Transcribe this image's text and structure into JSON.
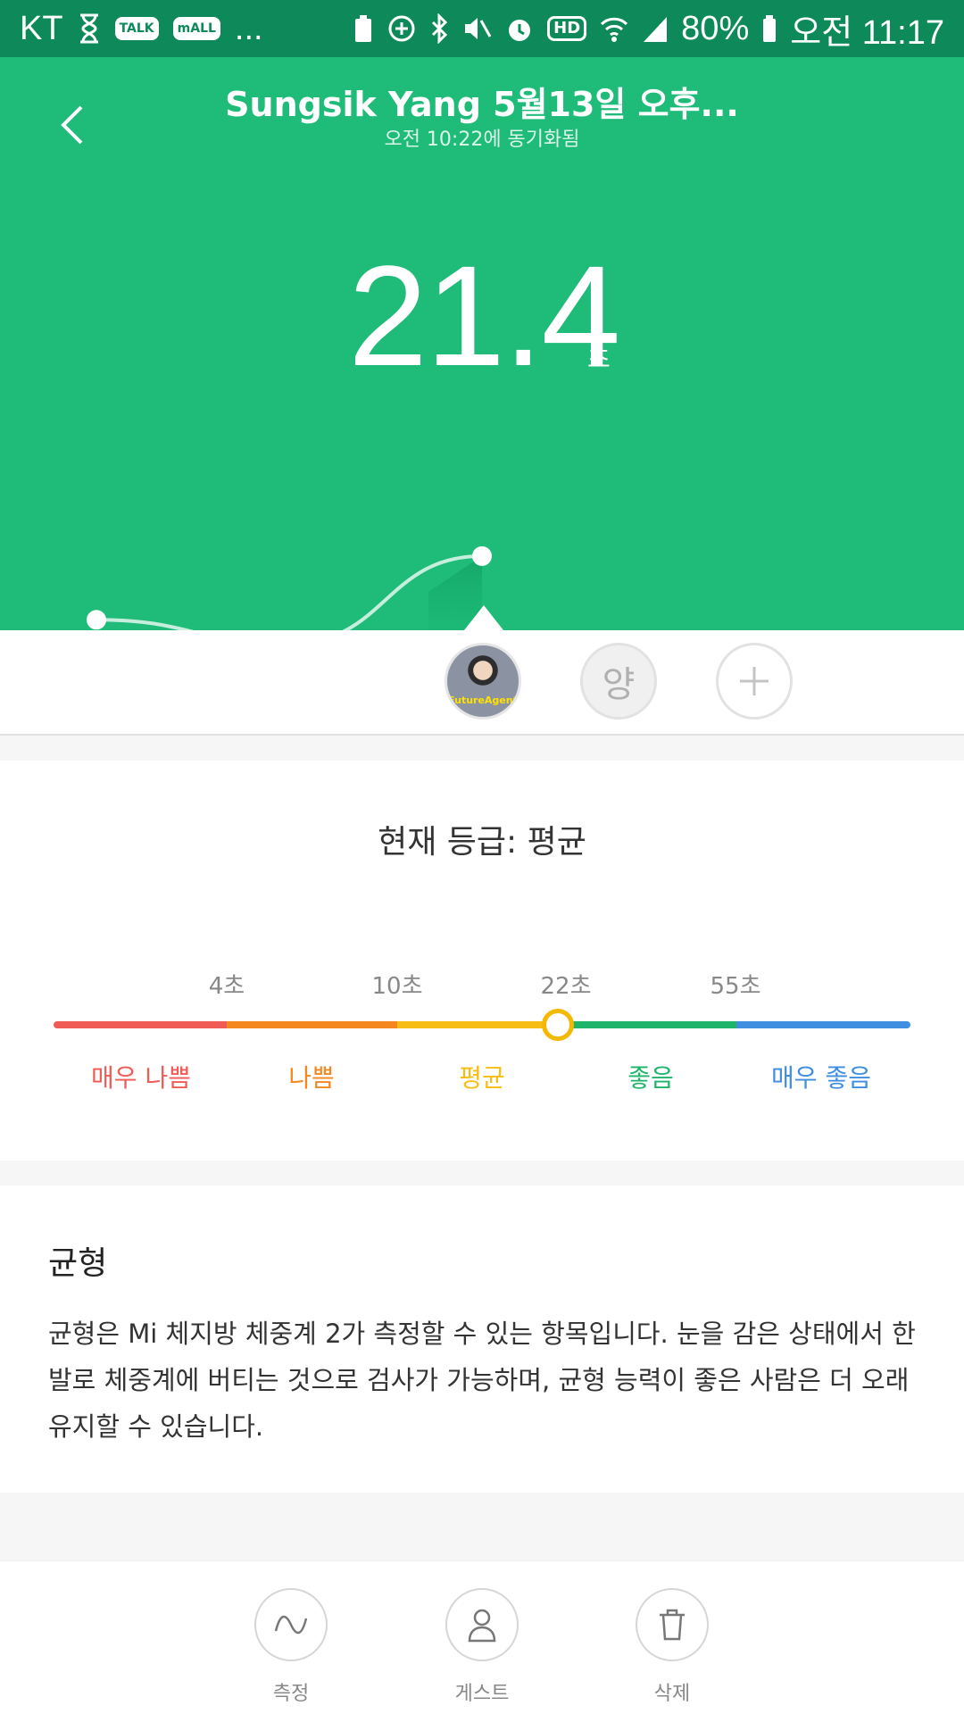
{
  "status_bar": {
    "carrier": "KT",
    "notif_talk": "TALK",
    "notif_mall": "mALL",
    "more": "...",
    "hd": "HD",
    "battery": "80%",
    "time": "오전 11:17"
  },
  "header": {
    "title": "Sungsik Yang 5월13일 오후...",
    "subtitle": "오전 10:22에 동기화됨",
    "value": "21.4",
    "unit": "초"
  },
  "users": {
    "photo_label": "FutureAgent",
    "guest_letter": "양"
  },
  "grade": {
    "title": "현재 등급: 평균",
    "thresholds": [
      "4초",
      "10초",
      "22초",
      "55초"
    ],
    "labels": [
      "매우 나쁨",
      "나쁨",
      "평균",
      "좋음",
      "매우 좋음"
    ],
    "colors": [
      "#f15b55",
      "#f5871f",
      "#f8bd12",
      "#1eb56a",
      "#3f8ee0"
    ]
  },
  "info": {
    "title": "균형",
    "body": "균형은 Mi 체지방 체중계 2가 측정할 수 있는 항목입니다. 눈을 감은 상태에서 한 발로 체중계에 버티는 것으로 검사가 가능하며, 균형 능력이 좋은 사람은 더 오래 유지할 수 있습니다."
  },
  "actions": {
    "measure": "측정",
    "guest": "게스트",
    "delete": "삭제"
  },
  "chart_data": {
    "type": "line",
    "series": [
      {
        "values": [
          19.8,
          19.2,
          21.4
        ]
      }
    ]
  }
}
